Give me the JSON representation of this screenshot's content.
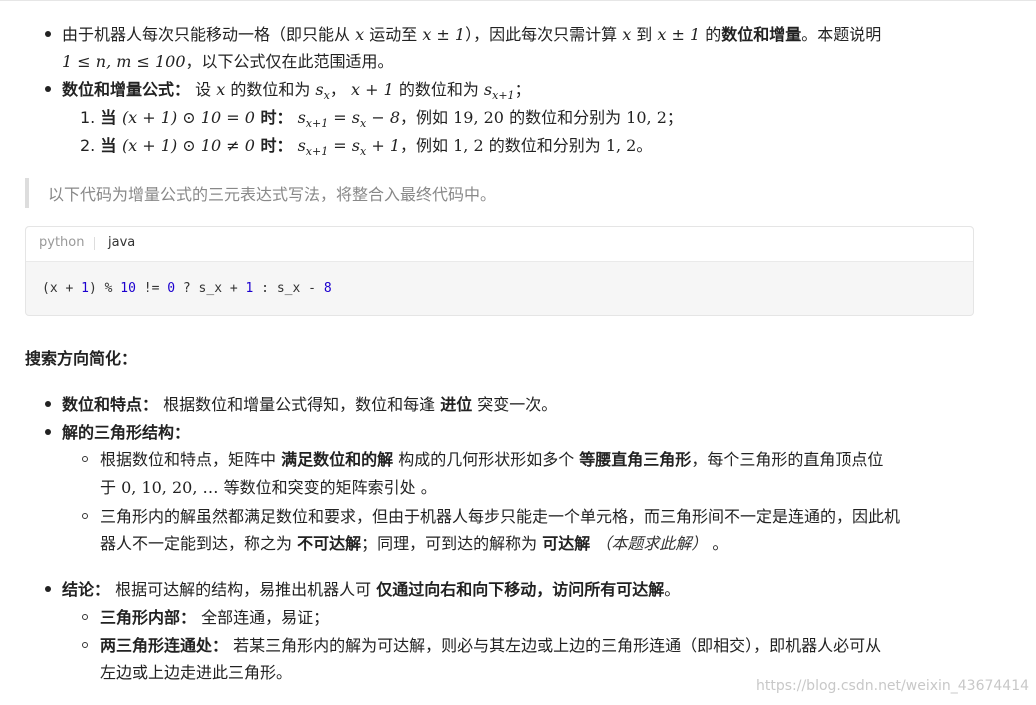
{
  "list1": {
    "item1_line1_a": "由于机器人每次只能移动一格（即只能从 ",
    "item1_line1_b": " 运动至 ",
    "item1_line1_c": "），因此每次只需计算 ",
    "item1_line1_d": " 到 ",
    "item1_line1_e": " 的",
    "item1_bold": "数位和增量",
    "item1_line1_f": "。本题说明",
    "item1_line2_b": "，以下公式仅在此范围适用。",
    "item2_bold": "数位和增量公式：",
    "item2_a": " 设 ",
    "item2_b": " 的数位和为 ",
    "item2_c": "， ",
    "item2_d": " 的数位和为 ",
    "item2_e": "；",
    "sub1_num": "1.",
    "sub1_bold_a": "当 ",
    "sub1_bold_b": " 时：",
    "sub1_a": "，例如 ",
    "sub1_b": " 的数位和分别为 ",
    "sub1_c": "；",
    "sub2_num": "2.",
    "sub2_bold_a": "当 ",
    "sub2_bold_b": " 时：",
    "sub2_a": "，例如 ",
    "sub2_b": " 的数位和分别为 ",
    "sub2_c": "。"
  },
  "math": {
    "x": "x",
    "x_pm1": "x ± 1",
    "range": "1 ≤ n, m ≤ 100",
    "sx": "s",
    "sx_sub": "x",
    "x_plus1": "x + 1",
    "sx1_sub": "x+1",
    "cond1": "(x + 1) ⊙ 10 = 0",
    "cond2": "(x + 1) ⊙ 10 ≠ 0",
    "eq1_rhs": " = s",
    "eq1_tail": " − 8",
    "eq2_tail": " + 1",
    "ex1": "19, 20",
    "ex1_res": "10, 2",
    "ex2": "1, 2",
    "ex2_res": "1, 2",
    "seq": "0, 10, 20, …"
  },
  "quote": "以下代码为增量公式的三元表达式写法，将整合入最终代码中。",
  "code": {
    "tabs": [
      "python",
      "java"
    ],
    "p1": "(x + ",
    "n1": "1",
    "p2": ") % ",
    "n2": "10",
    "p3": " != ",
    "n3": "0",
    "p4": " ? s_x + ",
    "n4": "1",
    "p5": " : s_x - ",
    "n5": "8"
  },
  "section_title": "搜索方向简化：",
  "list2": {
    "i1_bold": "数位和特点：",
    "i1_a": " 根据数位和增量公式得知，数位和每逢 ",
    "i1_bold2": "进位",
    "i1_b": " 突变一次。",
    "i2_bold": "解的三角形结构：",
    "s1_a": "根据数位和特点，矩阵中 ",
    "s1_bold": "满足数位和的解",
    "s1_b": " 构成的几何形状形如多个 ",
    "s1_bold2": "等腰直角三角形",
    "s1_c": "，每个三角形的直角顶点位",
    "s1_d": "于 ",
    "s1_e": " 等数位和突变的矩阵索引处 。",
    "s2_a": "三角形内的解虽然都满足数位和要求，但由于机器人每步只能走一个单元格，而三角形间不一定是连通的，因此机",
    "s2_b": "器人不一定能到达，称之为 ",
    "s2_bold": "不可达解",
    "s2_c": "；同理，可到达的解称为 ",
    "s2_bold2": "可达解",
    "s2_ital": "（本题求此解）",
    "s2_d": "。",
    "i3_bold": "结论：",
    "i3_a": " 根据可达解的结构，易推出机器人可 ",
    "i3_bold2": "仅通过向右和向下移动，访问所有可达解",
    "i3_b": "。",
    "t1_bold": "三角形内部：",
    "t1_a": " 全部连通，易证；",
    "t2_bold": "两三角形连通处：",
    "t2_a": " 若某三角形内的解为可达解，则必与其左边或上边的三角形连通（即相交），即机器人必可从",
    "t2_b": "左边或上边走进此三角形。"
  },
  "watermark": "https://blog.csdn.net/weixin_43674414"
}
